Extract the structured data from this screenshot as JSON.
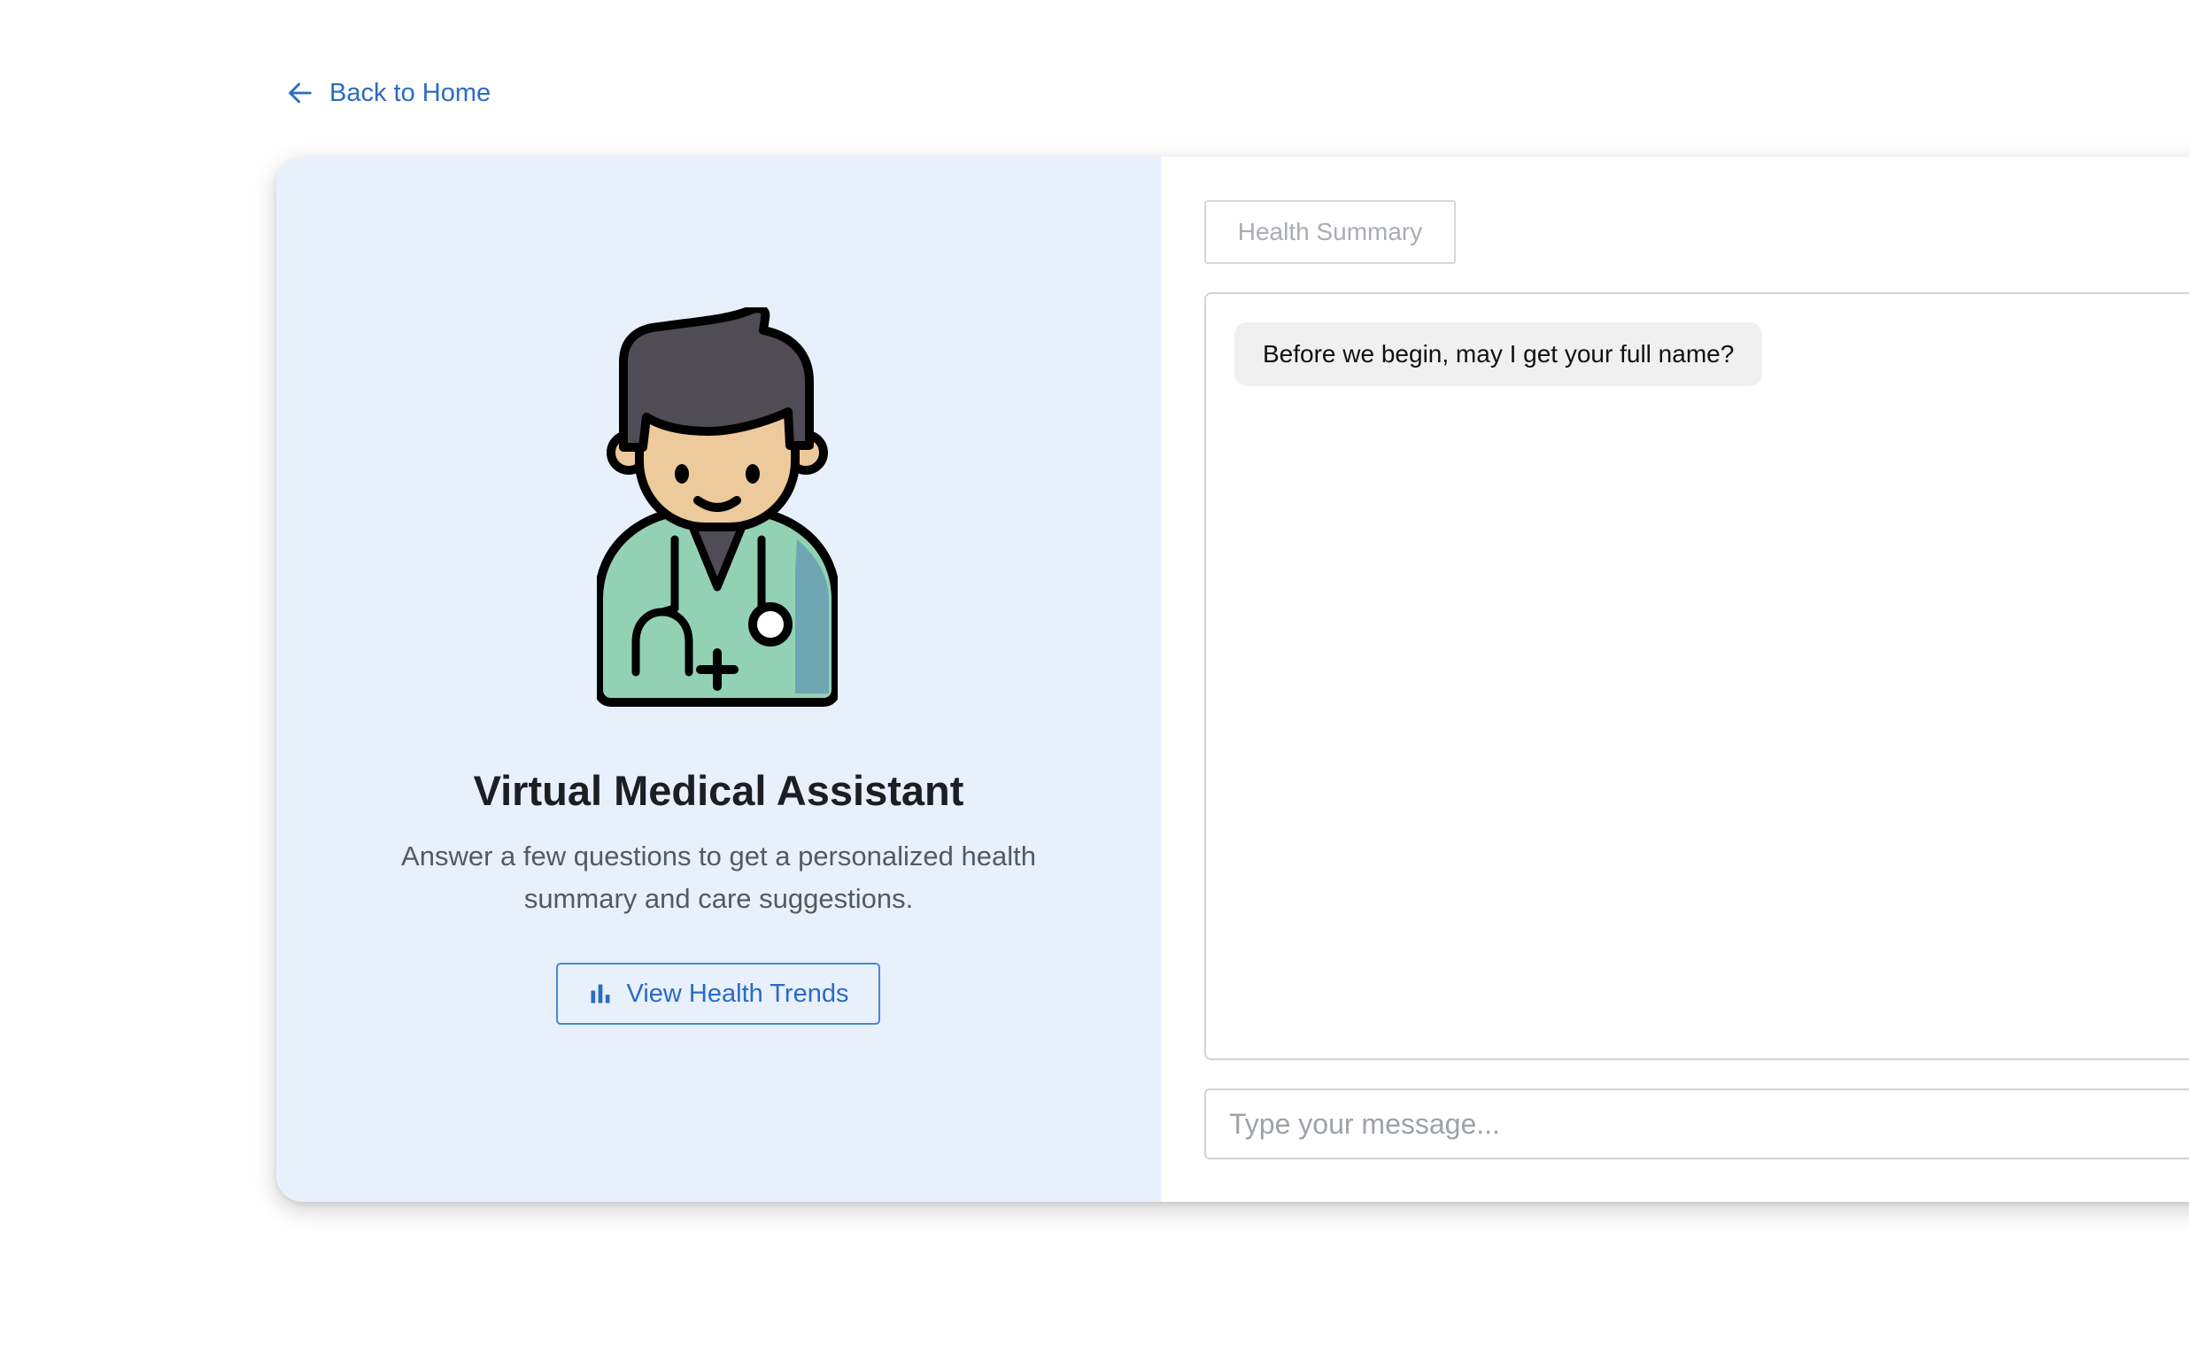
{
  "nav": {
    "back_label": "Back to Home",
    "back_icon": "arrow-left-icon"
  },
  "assistant": {
    "avatar_icon": "doctor-avatar-icon",
    "title": "Virtual Medical Assistant",
    "subtitle": "Answer a few questions to get a personalized health summary and care suggestions.",
    "trends_button_label": "View Health Trends",
    "trends_icon": "bar-chart-icon"
  },
  "chat": {
    "summary_button_label": "Health Summary",
    "messages": [
      {
        "sender": "assistant",
        "text": "Before we begin, may I get your full name?"
      }
    ],
    "input_placeholder": "Type your message...",
    "input_value": ""
  },
  "colors": {
    "accent": "#2a6bc4",
    "left_panel_bg": "#e8f0fc",
    "bubble_bg": "#f0f0f0"
  }
}
